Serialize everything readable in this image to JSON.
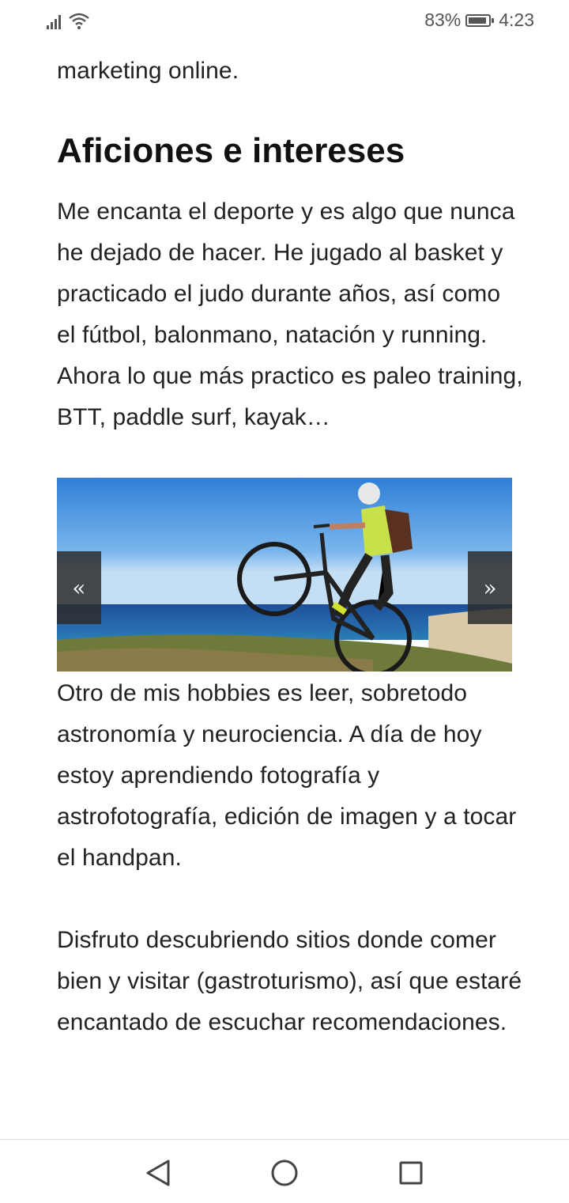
{
  "status_bar": {
    "battery": "83%",
    "time": "4:23",
    "icons": [
      "signal-icon",
      "wifi-icon",
      "battery-icon"
    ]
  },
  "content": {
    "top_text": "marketing online.",
    "heading": "Aficiones e intereses",
    "paragraph1": "Me encanta el deporte y es algo que nunca he dejado de hacer. He jugado al basket y practicado el judo durante años, así como el fútbol, balonmano, natación y running. Ahora lo que más practico es paleo training, BTT, paddle surf, kayak…",
    "slider": {
      "prev_label": "«",
      "next_label": "»"
    },
    "paragraph2": "Otro de mis hobbies es leer, sobretodo astronomía y neurociencia. A día de hoy estoy aprendiendo fotografía y astrofotografía, edición de imagen y a tocar el handpan.",
    "paragraph3": "Disfruto descubriendo sitios donde comer bien y visitar (gastroturismo), así que estaré encantado de escuchar recomendaciones."
  },
  "nav_bar": {
    "icons": [
      "back-icon",
      "home-icon",
      "recents-icon"
    ]
  }
}
